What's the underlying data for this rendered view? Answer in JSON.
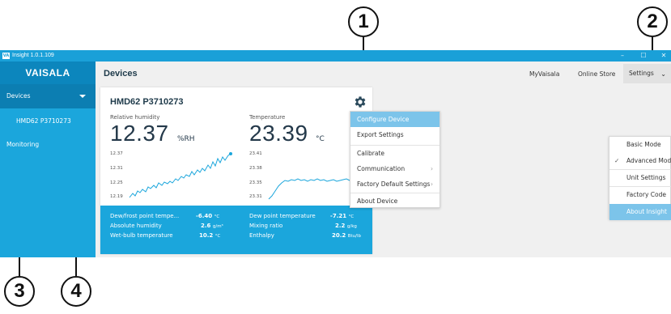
{
  "window": {
    "title": "Insight 1.0.1.109",
    "app_logo": "VA",
    "controls": [
      "–",
      "☐",
      "✕"
    ]
  },
  "sidebar": {
    "brand": "VAISALA",
    "devices_label": "Devices",
    "device_item": "HMD62 P3710273",
    "monitoring_label": "Monitoring"
  },
  "topnav": {
    "page_title": "Devices",
    "myvaisala": "MyVaisala",
    "online_store": "Online Store",
    "settings": "Settings"
  },
  "card": {
    "device_name": "HMD62 P3710273",
    "rh": {
      "label": "Relative humidity",
      "value": "12.37",
      "unit": "%RH",
      "ticks": [
        "12.37",
        "12.31",
        "12.25",
        "12.19"
      ]
    },
    "temp": {
      "label": "Temperature",
      "value": "23.39",
      "unit": "°C",
      "ticks": [
        "23.41",
        "23.38",
        "23.35",
        "23.31"
      ]
    },
    "stats": [
      {
        "label": "Dew/frost point tempe...",
        "value": "-6.40",
        "unit": "°C"
      },
      {
        "label": "Absolute humidity",
        "value": "2.6",
        "unit": "g/m³"
      },
      {
        "label": "Wet-bulb temperature",
        "value": "10.2",
        "unit": "°C"
      },
      {
        "label": "Dew point temperature",
        "value": "-7.21",
        "unit": "°C"
      },
      {
        "label": "Mixing ratio",
        "value": "2.2",
        "unit": "g/kg"
      },
      {
        "label": "Enthalpy",
        "value": "20.2",
        "unit": "Btu/lb"
      }
    ]
  },
  "device_menu": {
    "items": [
      "Configure Device",
      "Export Settings",
      "Calibrate",
      "Communication",
      "Factory Default Settings",
      "About Device"
    ],
    "highlight_color": "#7cc4ea"
  },
  "settings_menu": {
    "items": [
      "Basic Mode",
      "Advanced Mode",
      "Unit Settings",
      "Factory Code",
      "About Insight"
    ]
  },
  "callouts": [
    "1",
    "2",
    "3",
    "4"
  ],
  "colors": {
    "accent": "#1ba6dc",
    "accent_dark": "#0c7eb2",
    "titlebar": "#1aa0d8",
    "sparkline": "#1ba6dc"
  }
}
